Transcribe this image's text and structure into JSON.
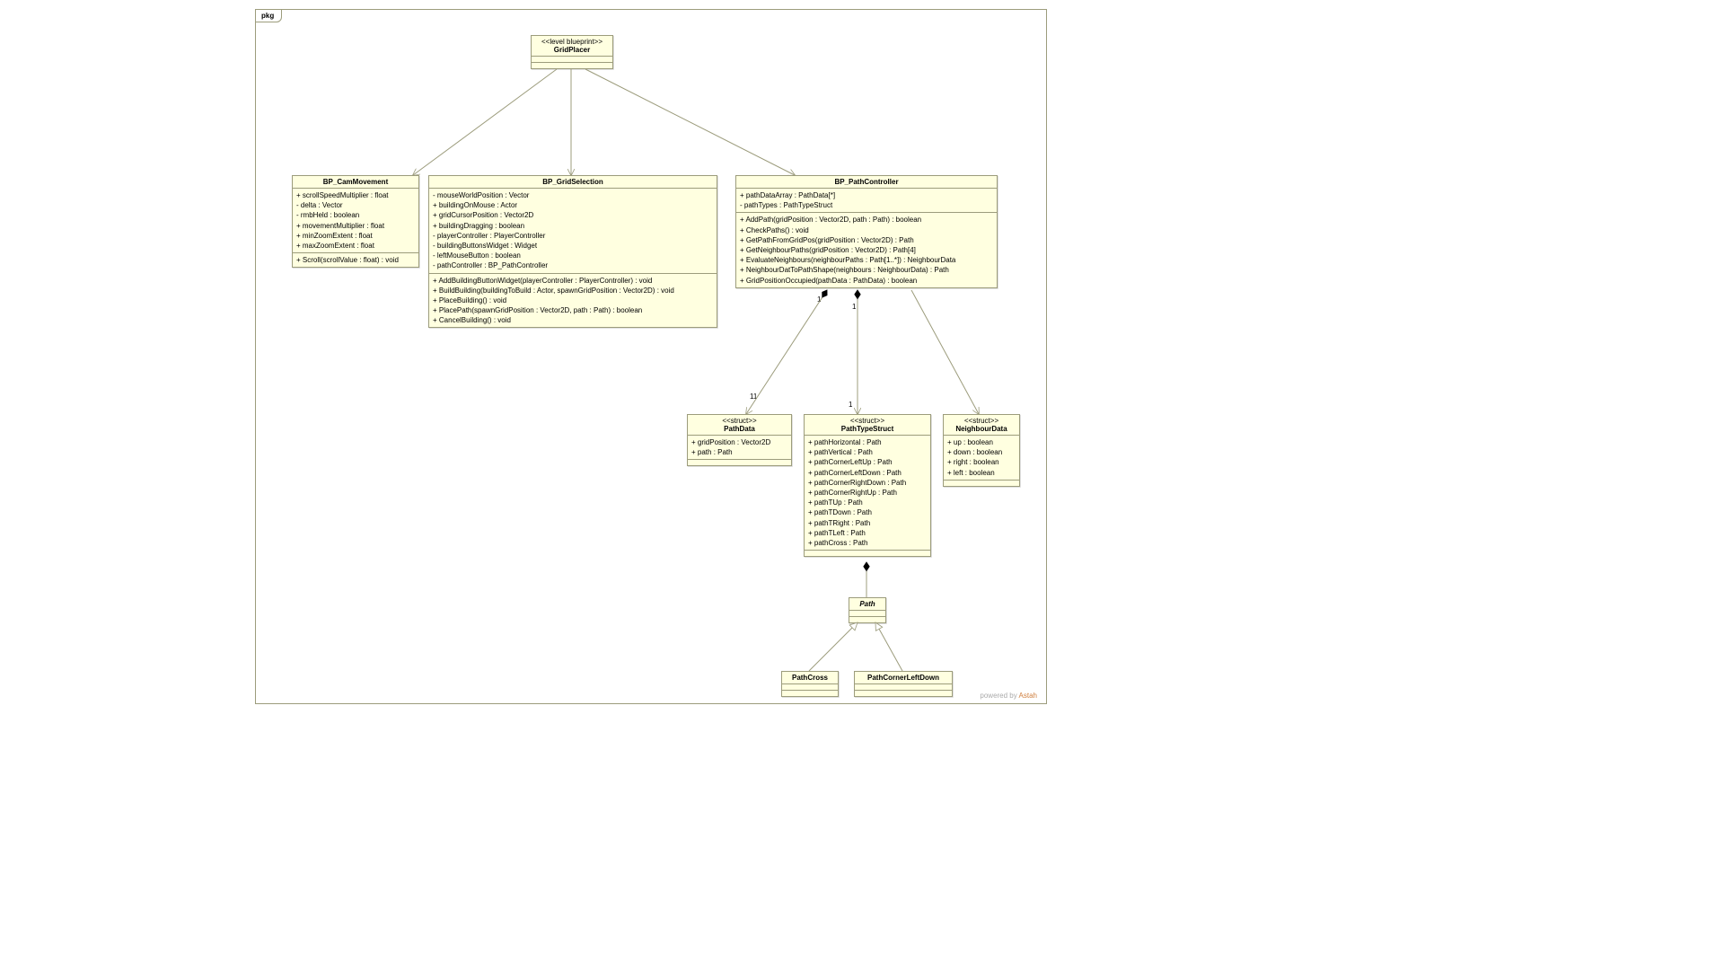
{
  "package": {
    "label": "pkg"
  },
  "poweredBy": {
    "prefix": "powered by ",
    "name": "Astah"
  },
  "gridPlacer": {
    "stereotype": "<<level blueprint>>",
    "name": "GridPlacer"
  },
  "camMovement": {
    "name": "BP_CamMovement",
    "attrs": [
      "+ scrollSpeedMultiplier : float",
      "- delta : Vector",
      "- rmbHeld : boolean",
      "+ movementMultiplier : float",
      "+ minZoomExtent : float",
      "+ maxZoomExtent : float"
    ],
    "ops": [
      "+ Scroll(scrollValue : float) : void"
    ]
  },
  "gridSelection": {
    "name": "BP_GridSelection",
    "attrs": [
      "- mouseWorldPosition : Vector",
      "+ buildingOnMouse : Actor",
      "+ gridCursorPosition : Vector2D",
      "+ buildingDragging : boolean",
      "- playerController : PlayerController",
      "- buildingButtonsWidget : Widget",
      "- leftMouseButton : boolean",
      "- pathController : BP_PathController"
    ],
    "ops": [
      "+ AddBuildingButtonWidget(playerController : PlayerController) : void",
      "+ BuildBuilding(buildingToBuild : Actor, spawnGridPosition : Vector2D) : void",
      "+ PlaceBuilding() : void",
      "+ PlacePath(spawnGridPosition : Vector2D, path : Path) : boolean",
      "+ CancelBuilding() : void"
    ]
  },
  "pathController": {
    "name": "BP_PathController",
    "attrs": [
      "+ pathDataArray : PathData[*]",
      "- pathTypes : PathTypeStruct"
    ],
    "ops": [
      "+ AddPath(gridPosition : Vector2D, path : Path) : boolean",
      "+ CheckPaths() : void",
      "+ GetPathFromGridPos(gridPosition : Vector2D) : Path",
      "+ GetNeighbourPaths(gridPosition : Vector2D) : Path[4]",
      "+ EvaluateNeighbours(neighbourPaths : Path[1..*]) : NeighbourData",
      "+ NeighbourDatToPathShape(neighbours : NeighbourData) : Path",
      "+ GridPositionOccupied(pathData : PathData) : boolean"
    ]
  },
  "pathData": {
    "stereotype": "<<struct>>",
    "name": "PathData",
    "attrs": [
      "+ gridPosition : Vector2D",
      "+ path : Path"
    ]
  },
  "pathTypeStruct": {
    "stereotype": "<<struct>>",
    "name": "PathTypeStruct",
    "attrs": [
      "+ pathHorizontal : Path",
      "+ pathVertical : Path",
      "+ pathCornerLeftUp : Path",
      "+ pathCornerLeftDown : Path",
      "+ pathCornerRightDown : Path",
      "+ pathCornerRightUp : Path",
      "+ pathTUp : Path",
      "+ pathTDown : Path",
      "+ pathTRight : Path",
      "+ pathTLeft : Path",
      "+ pathCross : Path"
    ]
  },
  "neighbourData": {
    "stereotype": "<<struct>>",
    "name": "NeighbourData",
    "attrs": [
      "+ up : boolean",
      "+ down : boolean",
      "+ right : boolean",
      "+ left : boolean"
    ]
  },
  "path": {
    "name": "Path"
  },
  "pathCross": {
    "name": "PathCross"
  },
  "pathCornerLeftDown": {
    "name": "PathCornerLeftDown"
  },
  "multiplicities": {
    "pc_top_left": "1",
    "pc_top_right": "1",
    "pathData_top": "11",
    "pathTypeStruct_top": "1"
  }
}
